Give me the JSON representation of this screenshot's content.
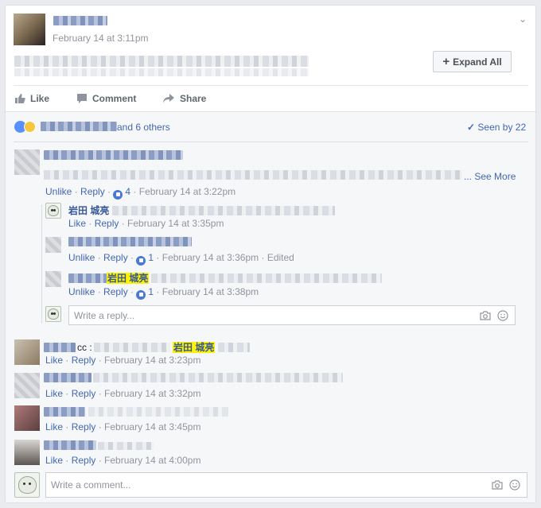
{
  "post": {
    "timestamp": "February 14 at 3:11pm",
    "expand_label": "Expand All",
    "actions": {
      "like": "Like",
      "comment": "Comment",
      "share": "Share"
    }
  },
  "reactions": {
    "others": "and 6 others",
    "seen": "Seen by 22"
  },
  "comments": [
    {
      "see_more": "... See More",
      "unlike": "Unlike",
      "reply": "Reply",
      "likes": "4",
      "time": "February 14 at 3:22pm"
    },
    {
      "like": "Like",
      "reply": "Reply",
      "time": "February 14 at 3:23pm",
      "prefix": "cc :",
      "mention": "岩田 城亮"
    },
    {
      "like": "Like",
      "reply": "Reply",
      "time": "February 14 at 3:32pm"
    },
    {
      "like": "Like",
      "reply": "Reply",
      "time": "February 14 at 3:45pm"
    },
    {
      "like": "Like",
      "reply": "Reply",
      "time": "February 14 at 4:00pm"
    }
  ],
  "replies": [
    {
      "name": "岩田 城亮",
      "like": "Like",
      "reply": "Reply",
      "time": "February 14 at 3:35pm"
    },
    {
      "unlike": "Unlike",
      "reply": "Reply",
      "likes": "1",
      "time": "February 14 at 3:36pm",
      "edited": "Edited"
    },
    {
      "mention": "岩田 城亮",
      "unlike": "Unlike",
      "reply": "Reply",
      "likes": "1",
      "time": "February 14 at 3:38pm"
    }
  ],
  "reply_input": {
    "placeholder": "Write a reply..."
  },
  "comment_input": {
    "placeholder": "Write a comment..."
  },
  "colors": {
    "link": "#4267b2",
    "highlight": "#fff200",
    "name": "#365899"
  }
}
